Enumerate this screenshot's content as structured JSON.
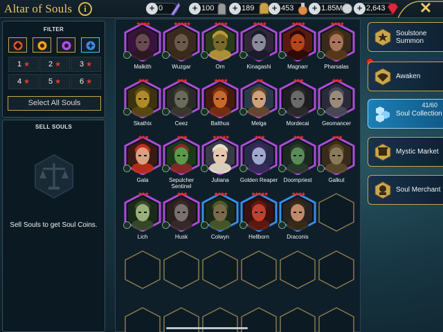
{
  "header": {
    "title": "Altar of Souls",
    "info_icon": "info-icon",
    "close_icon": "close-icon",
    "resources": [
      {
        "name": "shards",
        "value": "0",
        "icon": "shard-icon",
        "color": "#a590e8"
      },
      {
        "name": "auto-battle",
        "value": "100",
        "icon": "gauntlet-icon",
        "color": "#c8c8c8"
      },
      {
        "name": "ascension",
        "value": "189",
        "icon": "helmet-icon",
        "color": "#d4a94a"
      },
      {
        "name": "energy",
        "value": "453",
        "icon": "potion-icon",
        "color": "#e08a4a"
      },
      {
        "name": "silver",
        "value": "1.85M",
        "icon": "silver-icon",
        "color": "#d0d6da"
      },
      {
        "name": "gems",
        "value": "2,643",
        "icon": "gem-icon",
        "color": "#e0283a"
      }
    ]
  },
  "filter": {
    "heading": "FILTER",
    "affinities": [
      {
        "name": "force",
        "color": "#e25a2a",
        "selected": false
      },
      {
        "name": "magic",
        "color": "#f0a21a",
        "selected": false
      },
      {
        "name": "spirit",
        "color": "#b050e0",
        "selected": false
      },
      {
        "name": "void",
        "color": "#3a8ce8",
        "selected": true
      }
    ],
    "ranks": [
      "1",
      "2",
      "3",
      "4",
      "5",
      "6"
    ],
    "select_all": "Select All Souls"
  },
  "sell": {
    "heading": "SELL SOULS",
    "emblem_icon": "scales-icon",
    "description": "Sell Souls to get Soul Coins."
  },
  "souls": [
    {
      "name": "Malkith",
      "stars": 4,
      "border": "#b04ad8",
      "bg": "#3a1240",
      "skin": "#6a4a52",
      "hair": "#2a1a20"
    },
    {
      "name": "Wuzgar",
      "stars": 5,
      "border": "#b04ad8",
      "bg": "#3a2a20",
      "skin": "#6a5a4a",
      "hair": "#3a2a1a"
    },
    {
      "name": "Orn",
      "stars": 4,
      "border": "#b04ad8",
      "bg": "#2a3a1a",
      "skin": "#7a6a2a",
      "hair": "#b89a3a"
    },
    {
      "name": "Kinagashi",
      "stars": 4,
      "border": "#b04ad8",
      "bg": "#30283a",
      "skin": "#8a8a9a",
      "hair": "#1a1a2a"
    },
    {
      "name": "Magnarr",
      "stars": 4,
      "border": "#b04ad8",
      "bg": "#5a1a10",
      "skin": "#b4441a",
      "hair": "#2a0a08"
    },
    {
      "name": "Pharsalas",
      "stars": 4,
      "border": "#b04ad8",
      "bg": "#3a2a1a",
      "skin": "#a8745a",
      "hair": "#5a3a1a"
    },
    {
      "name": "Skathix",
      "stars": 3,
      "border": "#b04ad8",
      "bg": "#3a3210",
      "skin": "#b08a2a",
      "hair": "#5a4a10"
    },
    {
      "name": "Ceez",
      "stars": 3,
      "border": "#b04ad8",
      "bg": "#2a2a26",
      "skin": "#6a6a5a",
      "hair": "#3a3a30"
    },
    {
      "name": "Balthus",
      "stars": 4,
      "border": "#b04ad8",
      "bg": "#4a1a10",
      "skin": "#c86a2a",
      "hair": "#7a3010"
    },
    {
      "name": "Melga",
      "stars": 2,
      "border": "#b04ad8",
      "bg": "#2a3a4a",
      "skin": "#d0a07a",
      "hair": "#6a4a2a"
    },
    {
      "name": "Mordecai",
      "stars": 3,
      "border": "#b04ad8",
      "bg": "#1e1e22",
      "skin": "#6a6a6a",
      "hair": "#2a2a2a"
    },
    {
      "name": "Geomancer",
      "stars": 3,
      "border": "#b04ad8",
      "bg": "#2a2a3a",
      "skin": "#9a8a7a",
      "hair": "#4a4a5a"
    },
    {
      "name": "Gala",
      "stars": 3,
      "border": "#b04ad8",
      "bg": "#3a1a14",
      "skin": "#d8a080",
      "hair": "#c0301a"
    },
    {
      "name": "Sepulcher Sentinel",
      "stars": 3,
      "border": "#b04ad8",
      "bg": "#1a3a1a",
      "skin": "#5a9a4a",
      "hair": "#8a2a2a"
    },
    {
      "name": "Juliana",
      "stars": 5,
      "border": "#b04ad8",
      "bg": "#3a3a4a",
      "skin": "#e6c8b0",
      "hair": "#e8e0c8"
    },
    {
      "name": "Golden Reaper",
      "stars": 3,
      "border": "#b04ad8",
      "bg": "#2a2a4a",
      "skin": "#a0a8d0",
      "hair": "#3a2a5a"
    },
    {
      "name": "Doompriest",
      "stars": 3,
      "border": "#b04ad8",
      "bg": "#1a2a20",
      "skin": "#5a8a5a",
      "hair": "#2a3a2a"
    },
    {
      "name": "Galkut",
      "stars": 3,
      "border": "#b04ad8",
      "bg": "#3a2a1a",
      "skin": "#8a7a5a",
      "hair": "#5a4a2a"
    },
    {
      "name": "Lich",
      "stars": 3,
      "border": "#b04ad8",
      "bg": "#1a2a1a",
      "skin": "#9ab07a",
      "hair": "#3a4a2a"
    },
    {
      "name": "Husk",
      "stars": 3,
      "border": "#b04ad8",
      "bg": "#2a2020",
      "skin": "#7a7070",
      "hair": "#3a2a2a"
    },
    {
      "name": "Colwyn",
      "stars": 4,
      "border": "#3a8ce8",
      "bg": "#1a2a1a",
      "skin": "#7a6a4a",
      "hair": "#4a5a2a"
    },
    {
      "name": "Hellborn",
      "stars": 5,
      "border": "#3a8ce8",
      "bg": "#3a1010",
      "skin": "#c04030",
      "hair": "#601a10"
    },
    {
      "name": "Draconis",
      "stars": 4,
      "border": "#3a8ce8",
      "bg": "#2a2420",
      "skin": "#c08a6a",
      "hair": "#3a2a1a"
    }
  ],
  "menu": [
    {
      "label": "Soulstone Summon",
      "icon": "soulstone-icon",
      "active": false,
      "count": ""
    },
    {
      "label": "Awaken",
      "icon": "awaken-icon",
      "active": false,
      "count": ""
    },
    {
      "label": "Soul Collection",
      "icon": "soul-collection-icon",
      "active": true,
      "count": "41/60"
    },
    {
      "label": "Mystic Market",
      "icon": "market-icon",
      "active": false,
      "count": ""
    },
    {
      "label": "Soul Merchant",
      "icon": "merchant-icon",
      "active": false,
      "count": ""
    }
  ],
  "colors": {
    "gold": "#c9a64e",
    "star_red": "#e23a3a",
    "active_blue": "#1c7fb4",
    "notification_red": "#e62a2a"
  }
}
